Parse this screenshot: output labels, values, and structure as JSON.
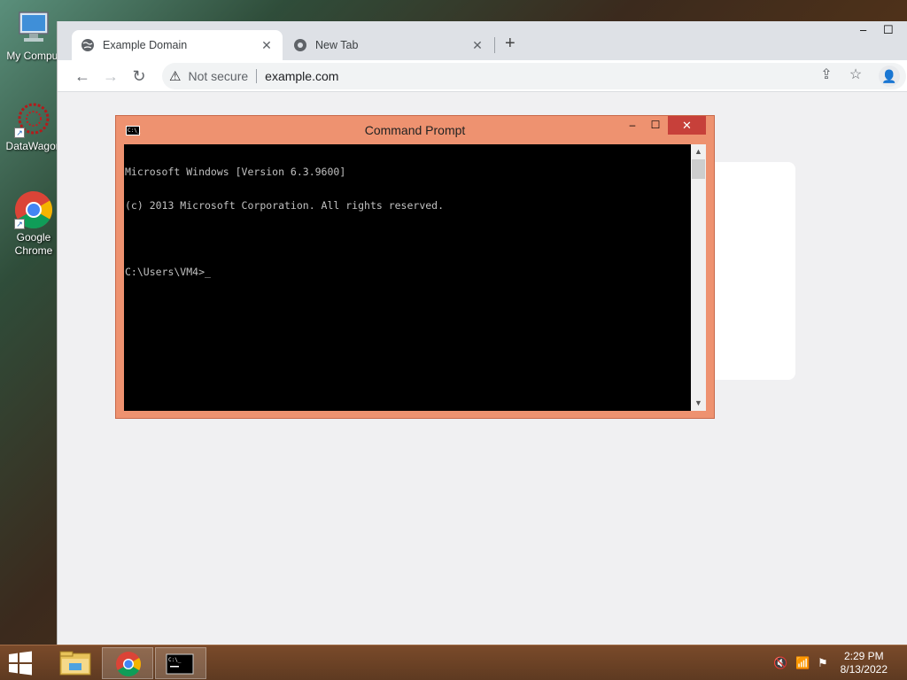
{
  "desktop": {
    "icons": [
      {
        "label": "My Comput",
        "icon": "computer-icon"
      },
      {
        "label": "DataWagon",
        "icon": "datawagon-icon"
      },
      {
        "label": "Google Chrome",
        "icon": "chrome-icon"
      }
    ]
  },
  "browser": {
    "tabs": [
      {
        "title": "Example Domain",
        "icon": "globe-icon",
        "active": true
      },
      {
        "title": "New Tab",
        "icon": "chrome-icon",
        "active": false
      }
    ],
    "new_tab_symbol": "+",
    "window_controls": {
      "minimize": "–",
      "maximize": "☐"
    },
    "nav": {
      "back": "←",
      "forward": "→",
      "reload": "↻"
    },
    "omnibox": {
      "security_text": "Not secure",
      "url": "example.com"
    },
    "toolbar_icons": {
      "share": "⇪",
      "bookmark": "☆",
      "profile": "👤"
    }
  },
  "cmd": {
    "title": "Command Prompt",
    "app_icon_text": "C:\\_",
    "controls": {
      "minimize": "–",
      "maximize": "☐",
      "close": "✕"
    },
    "lines": [
      "Microsoft Windows [Version 6.3.9600]",
      "(c) 2013 Microsoft Corporation. All rights reserved.",
      "",
      "C:\\Users\\VM4>_"
    ],
    "scroll_up": "▲",
    "scroll_down": "▼"
  },
  "taskbar": {
    "tray": {
      "volume": "🔇",
      "network": "📶",
      "flag": "⚑"
    },
    "clock": {
      "time": "2:29 PM",
      "date": "8/13/2022"
    }
  },
  "colors": {
    "cmd_frame": "#ee9270",
    "cmd_close": "#c7403a",
    "taskbar": "#6a4225"
  }
}
